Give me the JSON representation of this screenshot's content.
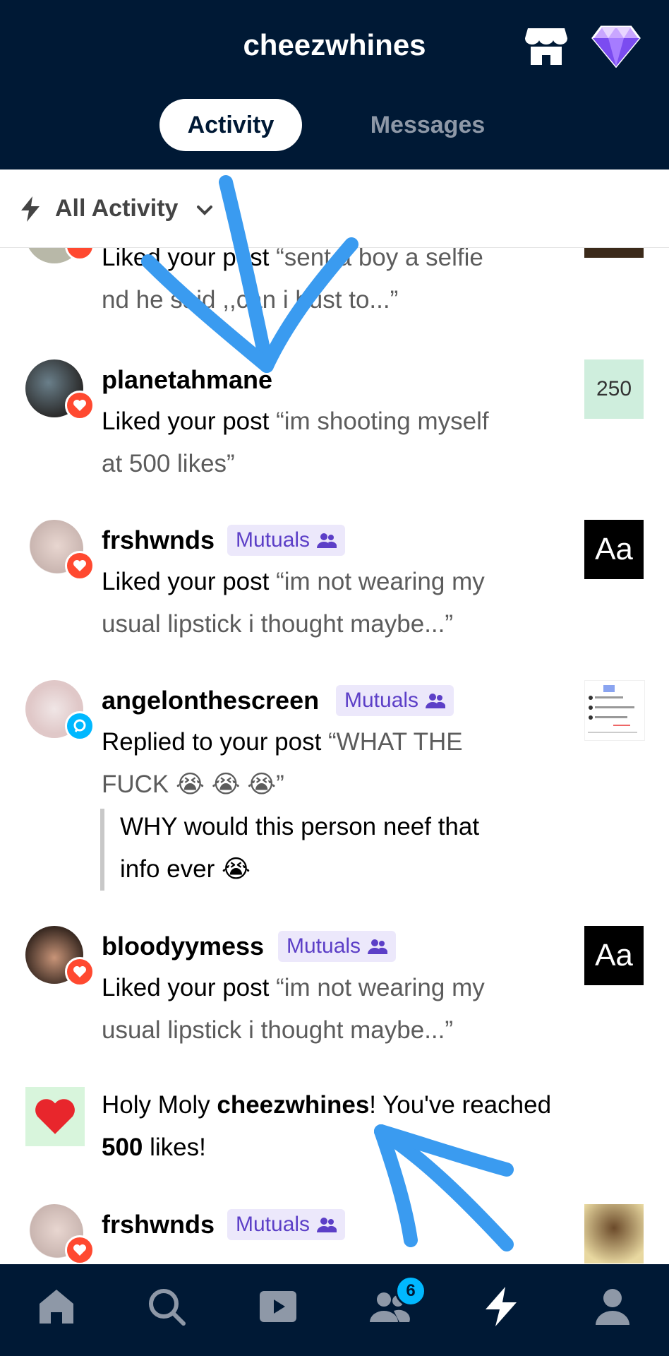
{
  "header": {
    "title": "cheezwhines",
    "tabs": [
      {
        "label": "Activity"
      },
      {
        "label": "Messages"
      }
    ]
  },
  "filter": {
    "label": "All Activity"
  },
  "feed": {
    "partial_top": {
      "line1_start": "Liked your post ",
      "line1_quote": "“sent a boy a selfie",
      "line2": "nd he said ,,can i bust to...”"
    },
    "items": [
      {
        "user": "planetahmane",
        "line1_action": "Liked your post ",
        "line1_quote": "“im shooting myself",
        "line2": "at 500 likes”",
        "thumb_text": "250"
      },
      {
        "user": "frshwnds",
        "mutual": "Mutuals",
        "line1_action": "Liked your post ",
        "line1_quote": "“im not wearing my",
        "line2": "usual lipstick i thought maybe...”",
        "thumb_text": "Aa"
      },
      {
        "user": "angelonthescreen",
        "mutual": "Mutuals",
        "line1_action": "Replied to your post ",
        "line1_quote": "“WHAT THE",
        "line2": "FUCK 😭 😭 😭”",
        "reply_line1": "WHY would this person neef that",
        "reply_line2": "info ever 😭"
      },
      {
        "user": "bloodyymess",
        "mutual": "Mutuals",
        "line1_action": "Liked your post ",
        "line1_quote": "“im not wearing my",
        "line2": "usual lipstick i thought maybe...”",
        "thumb_text": "Aa"
      },
      {
        "milestone_pre": "Holy Moly ",
        "milestone_name": "cheezwhines",
        "milestone_post": "! You've reached",
        "milestone_count": "500",
        "milestone_tail": " likes!"
      },
      {
        "user": "frshwnds",
        "mutual": "Mutuals"
      }
    ]
  },
  "nav": {
    "badge_count": "6",
    "items": [
      "home-icon",
      "search-icon",
      "video-icon",
      "people-icon",
      "activity-icon",
      "account-icon"
    ]
  },
  "colors": {
    "header_bg": "#001935",
    "like": "#ff4930",
    "reply": "#00b8ff",
    "mutual_text": "#5c3fc7",
    "mutual_bg": "#ece8fb",
    "annotation": "#3a9bf0"
  }
}
